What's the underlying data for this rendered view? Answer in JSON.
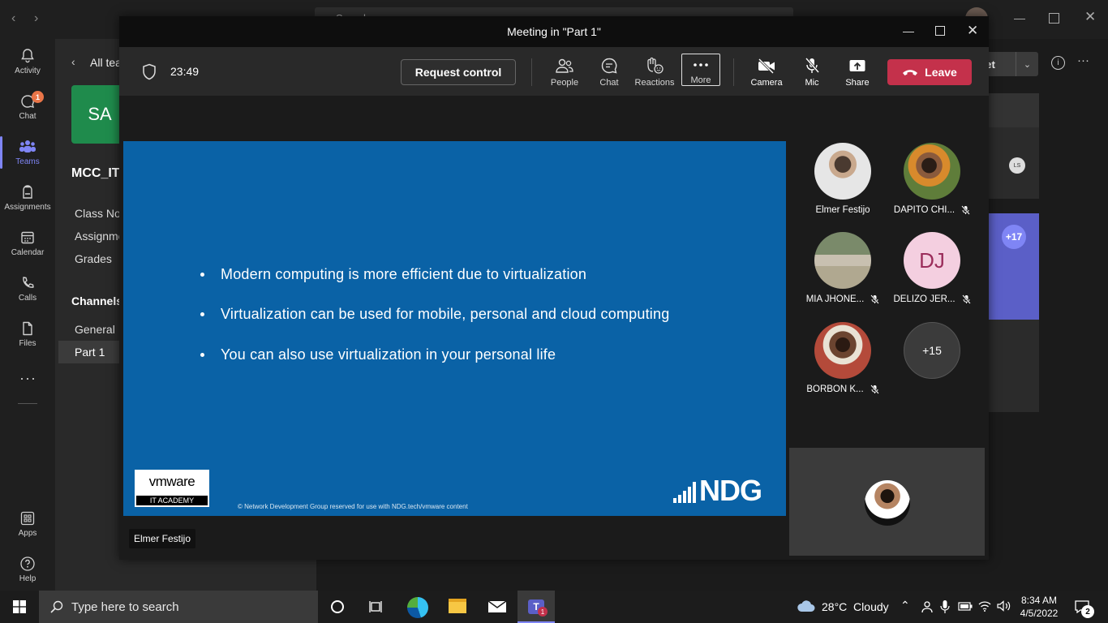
{
  "teams": {
    "search_placeholder": "Search",
    "rail": [
      {
        "label": "Activity",
        "icon": "bell-icon"
      },
      {
        "label": "Chat",
        "icon": "chat-icon",
        "badge": "1"
      },
      {
        "label": "Teams",
        "icon": "teams-icon",
        "active": true
      },
      {
        "label": "Assignments",
        "icon": "backpack-icon"
      },
      {
        "label": "Calendar",
        "icon": "calendar-icon"
      },
      {
        "label": "Calls",
        "icon": "phone-icon"
      },
      {
        "label": "Files",
        "icon": "file-icon"
      },
      {
        "label": "Apps",
        "icon": "apps-icon"
      },
      {
        "label": "Help",
        "icon": "help-icon"
      }
    ],
    "back_label": "All tea",
    "team_initials": "SA",
    "team_name": "MCC_IT",
    "nav": [
      "Class No",
      "Assignme",
      "Grades"
    ],
    "channels_header": "Channels",
    "channels": [
      "General",
      "Part 1"
    ],
    "meet_button": "eet",
    "extra_count": "+17",
    "avatar_initials": "LS"
  },
  "meeting": {
    "window_title": "Meeting in \"Part 1\"",
    "timer": "23:49",
    "request_control": "Request control",
    "toolbar": [
      {
        "label": "People",
        "icon": "people-icon"
      },
      {
        "label": "Chat",
        "icon": "chat-icon"
      },
      {
        "label": "Reactions",
        "icon": "reactions-icon"
      },
      {
        "label": "More",
        "icon": "more-icon"
      },
      {
        "label": "Camera",
        "icon": "camera-off-icon"
      },
      {
        "label": "Mic",
        "icon": "mic-off-icon"
      },
      {
        "label": "Share",
        "icon": "share-icon"
      }
    ],
    "leave": "Leave",
    "slide": {
      "bullets": [
        "Modern computing is more efficient due to virtualization",
        "Virtualization can be used for mobile, personal and cloud computing",
        "You can also use virtualization in your personal life"
      ],
      "vmware_logo": "vmware",
      "vmware_sub": "IT ACADEMY",
      "copyright": "© Network Development Group reserved for use with NDG.tech/vmware content",
      "ndg_logo": "NDG"
    },
    "presenter_name": "Elmer Festijo",
    "participants": [
      {
        "name": "Elmer Festijo",
        "muted": false
      },
      {
        "name": "DAPITO CHI...",
        "muted": true
      },
      {
        "name": "MIA JHONE...",
        "muted": true
      },
      {
        "name": "DELIZO JER...",
        "muted": true,
        "initials": "DJ"
      },
      {
        "name": "BORBON K...",
        "muted": true
      }
    ],
    "overflow_count": "+15"
  },
  "taskbar": {
    "search_placeholder": "Type here to search",
    "weather": "28°C  Cloudy",
    "time": "8:34 AM",
    "date": "4/5/2022",
    "notification_count": "2",
    "teams_badge": "1"
  },
  "colors": {
    "accent": "#7f85f5",
    "leave": "#c4314b",
    "slide_bg": "#0a62a6",
    "badge": "#e97548"
  }
}
